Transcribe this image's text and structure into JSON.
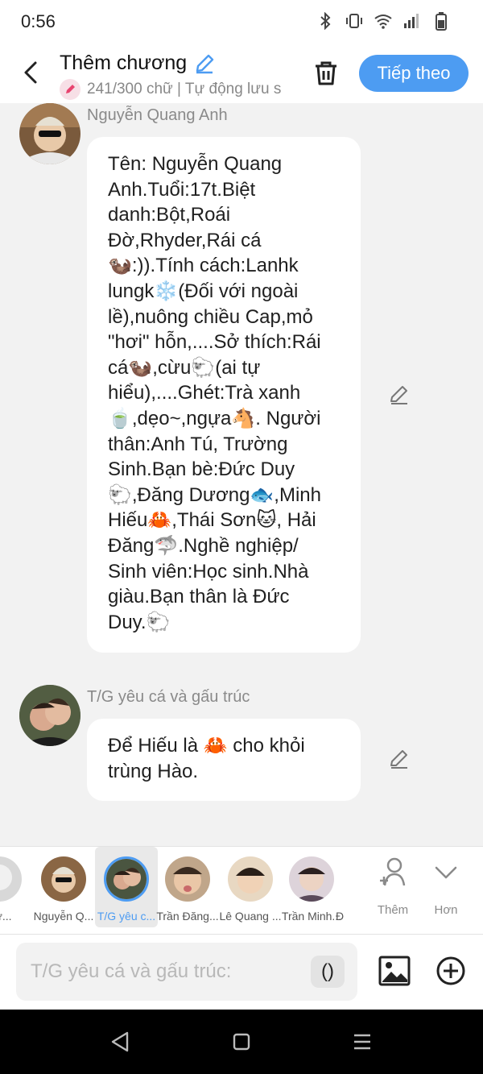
{
  "status": {
    "time": "0:56"
  },
  "header": {
    "title": "Thêm chương",
    "subtitle": "241/300 chữ | Tự động lưu s",
    "next_label": "Tiếp theo"
  },
  "messages": [
    {
      "sender": "Nguyễn Quang Anh",
      "lines": [
        "Tên: Nguyễn Quang",
        "Anh.Tuổi:17t.Biệt",
        "danh:Bột,Roái",
        "Đờ,Rhyder,Rái cá",
        "🦦:)).Tính cách:Lanhk",
        "lungk❄️(Đối với ngoài",
        "lề),nuông chiều Cap,mỏ",
        "\"hơi\" hỗn,....Sở thích:Rái",
        "cá🦦,cừu🐑(ai tự",
        "hiểu),....Ghét:Trà xanh",
        "🍵,dẹo~,ngựa🐴. Người",
        "thân:Anh Tú, Trường",
        "Sinh.Bạn bè:Đức Duy",
        "🐑,Đăng Dương🐟,Minh",
        "Hiếu🦀,Thái Sơn🐱, Hải",
        "Đăng🦈.Nghề nghiệp/",
        "Sinh viên:Học sinh.Nhà",
        "giàu.Bạn thân là Đức",
        "Duy.🐑"
      ]
    },
    {
      "sender": "T/G yêu cá và gấu trúc",
      "lines": [
        "Để Hiếu là 🦀 cho khỏi",
        "trùng Hào."
      ]
    }
  ],
  "characters": [
    {
      "name": "Đứ..."
    },
    {
      "name": "Nguyễn Q..."
    },
    {
      "name": "T/G yêu c..."
    },
    {
      "name": "Trần Đăng..."
    },
    {
      "name": "Lê Quang ..."
    },
    {
      "name": "Trần Minh..."
    },
    {
      "name": "Đ"
    }
  ],
  "strip_actions": {
    "add": "Thêm",
    "more": "Hơn"
  },
  "composer": {
    "placeholder": "T/G yêu cá và gấu trúc:",
    "paren": "()"
  },
  "colors": {
    "accent": "#4d9cf2",
    "background": "#f2f2f2"
  }
}
